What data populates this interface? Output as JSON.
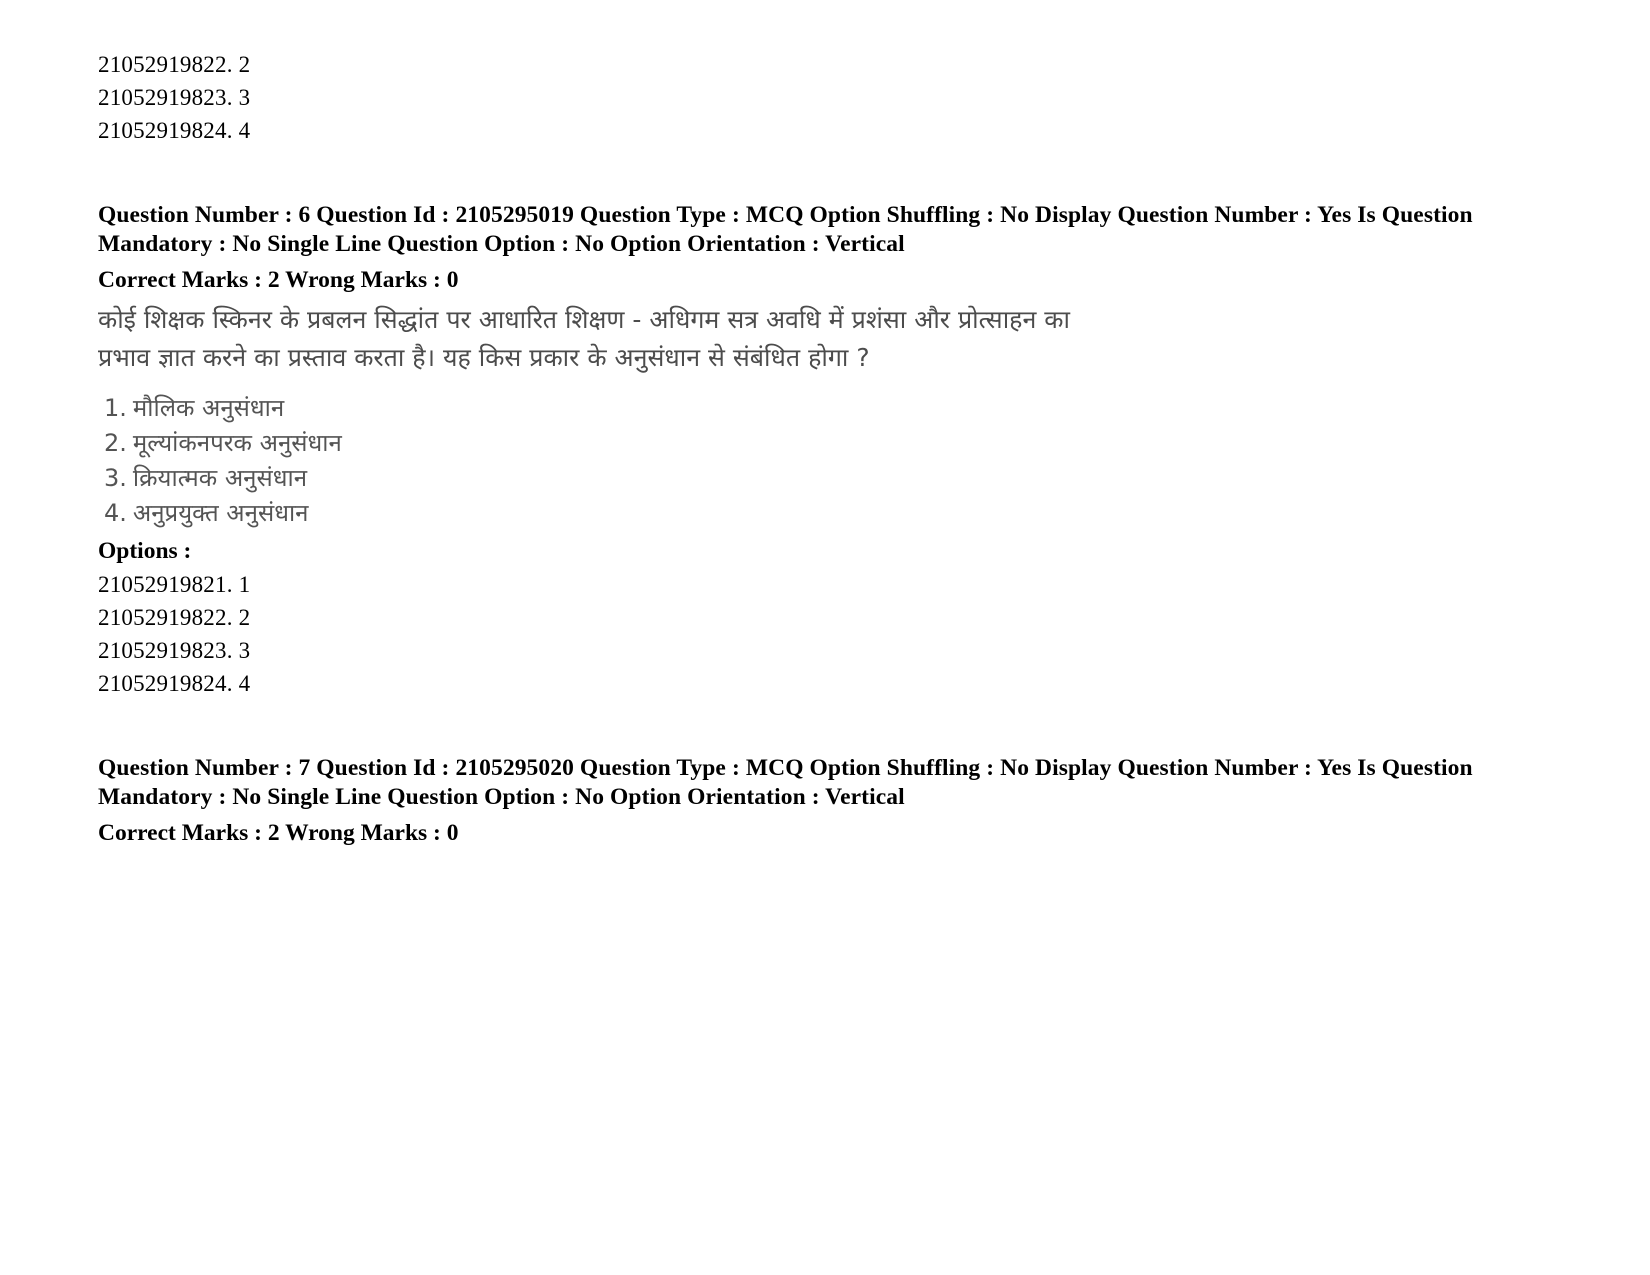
{
  "document": {
    "kind": "exam-question-paper-page",
    "language_note": "Hindi question stem rendered as scanned image"
  },
  "previous_question_trailing_option_ids": [
    "21052919822. 2",
    "21052919823. 3",
    "21052919824. 4"
  ],
  "questions": [
    {
      "header_line_1": "Question Number : 6 Question Id : 2105295019 Question Type : MCQ Option Shuffling : No Display Question Number : Yes Is Question",
      "header_line_2": "Mandatory : No Single Line Question Option : No Option Orientation : Vertical",
      "marks_line": "Correct Marks : 2 Wrong Marks : 0",
      "question_number": "6",
      "question_id": "2105295019",
      "question_type": "MCQ",
      "option_shuffling": "No",
      "display_question_number": "Yes",
      "is_question_mandatory": "No",
      "single_line_question_option": "No",
      "option_orientation": "Vertical",
      "correct_marks": "2",
      "wrong_marks": "0",
      "stem_lines": [
        "कोई शिक्षक स्किनर के प्रबलन सिद्धांत पर आधारित शिक्षण - अधिगम सत्र अवधि में प्रशंसा और प्रोत्साहन का",
        "प्रभाव ज्ञात करने का प्रस्ताव करता है। यह किस प्रकार के अनुसंधान से संबंधित होगा ?"
      ],
      "choices": [
        {
          "num": "1.",
          "text": "मौलिक अनुसंधान"
        },
        {
          "num": "2.",
          "text": "मूल्यांकनपरक अनुसंधान"
        },
        {
          "num": "3.",
          "text": "क्रियात्मक अनुसंधान"
        },
        {
          "num": "4.",
          "text": "अनुप्रयुक्त अनुसंधान"
        }
      ],
      "options_label": "Options :",
      "option_ids": [
        "21052919821. 1",
        "21052919822. 2",
        "21052919823. 3",
        "21052919824. 4"
      ]
    },
    {
      "header_line_1": "Question Number : 7 Question Id : 2105295020 Question Type : MCQ Option Shuffling : No Display Question Number : Yes Is Question",
      "header_line_2": "Mandatory : No Single Line Question Option : No Option Orientation : Vertical",
      "marks_line": "Correct Marks : 2 Wrong Marks : 0",
      "question_number": "7",
      "question_id": "2105295020",
      "question_type": "MCQ",
      "option_shuffling": "No",
      "display_question_number": "Yes",
      "is_question_mandatory": "No",
      "single_line_question_option": "No",
      "option_orientation": "Vertical",
      "correct_marks": "2",
      "wrong_marks": "0"
    }
  ]
}
